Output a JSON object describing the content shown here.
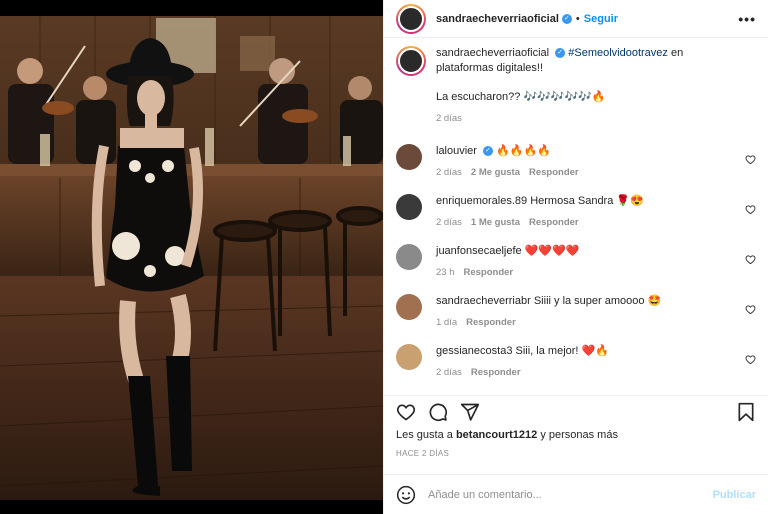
{
  "post": {
    "username": "sandraecheverriaoficial",
    "follow_label": "Seguir",
    "dot": "•"
  },
  "caption": {
    "username": "sandraecheverriaoficial",
    "hashtag": "#Semeolvidootravez",
    "text_after_hashtag": "en plataformas digitales!!",
    "line2": "La escucharon?? 🎶🎶🎶🎶🎶🔥",
    "time": "2 días"
  },
  "comments": [
    {
      "username": "lalouvier",
      "text": "🔥🔥🔥🔥",
      "time": "2 días",
      "likes": "2 Me gusta",
      "reply": "Responder",
      "verified": true,
      "avatar_color": "#6b4a3a"
    },
    {
      "username": "enriquemorales.89",
      "text": "Hermosa Sandra 🌹😍",
      "time": "2 días",
      "likes": "1 Me gusta",
      "reply": "Responder",
      "verified": false,
      "avatar_color": "#3a3a3a"
    },
    {
      "username": "juanfonsecaeljefe",
      "text": "❤️❤️❤️❤️",
      "time": "23 h",
      "likes": "",
      "reply": "Responder",
      "verified": false,
      "avatar_color": "#8a8a8a"
    },
    {
      "username": "sandraecheverriabr",
      "text": "Siiii y la super amoooo 🤩",
      "time": "1 día",
      "likes": "",
      "reply": "Responder",
      "verified": false,
      "avatar_color": "#a07050"
    },
    {
      "username": "gessianecosta3",
      "text": "Siii, la mejor! ❤️🔥",
      "time": "2 días",
      "likes": "",
      "reply": "Responder",
      "verified": false,
      "avatar_color": "#c9a070"
    }
  ],
  "likes_line": {
    "prefix": "Les gusta a",
    "user": "betancourt1212",
    "suffix": "y personas más"
  },
  "posted_ago": "HACE 2 DÍAS",
  "composer": {
    "placeholder": "Añade un comentario...",
    "publish_label": "Publicar"
  },
  "icons": {
    "header_more": "more-options-icon",
    "like": "heart-icon",
    "comment": "comment-icon",
    "share": "share-icon",
    "save": "bookmark-icon",
    "emoji": "emoji-icon"
  },
  "colors": {
    "link_blue": "#0095f6",
    "verified_blue": "#3897f0",
    "muted": "#8e8e8e",
    "publish_disabled": "#b2dffc"
  }
}
